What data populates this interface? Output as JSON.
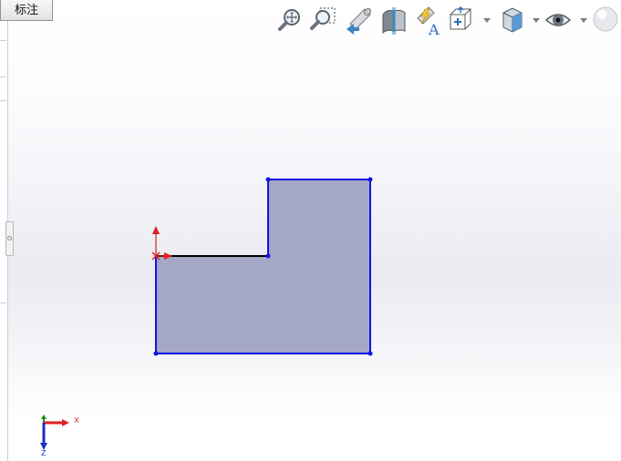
{
  "app": {
    "tab_label": "标注"
  },
  "toolbar": {
    "items": [
      {
        "icon": "zoom-to-fit-icon"
      },
      {
        "icon": "zoom-to-area-icon"
      },
      {
        "icon": "previous-view-icon"
      },
      {
        "icon": "section-view-icon"
      },
      {
        "icon": "dynamic-annotation-view-icon"
      },
      {
        "icon": "view-orientation-icon",
        "has_dropdown": true
      },
      {
        "icon": "display-style-icon",
        "has_dropdown": true
      },
      {
        "icon": "hide-show-items-icon",
        "has_dropdown": true
      },
      {
        "icon": "edit-appearance-icon"
      }
    ]
  },
  "triad": {
    "x_label": "X",
    "z_label": "Z",
    "colors": {
      "x": "#e02020",
      "y": "#1a8f1a",
      "z": "#1c2fbf"
    }
  },
  "sketch": {
    "fill_color": "#a4a7c6",
    "edge_color": "#1212e6",
    "selected_edge_color": "#000000",
    "origin_color": "#e02020"
  }
}
